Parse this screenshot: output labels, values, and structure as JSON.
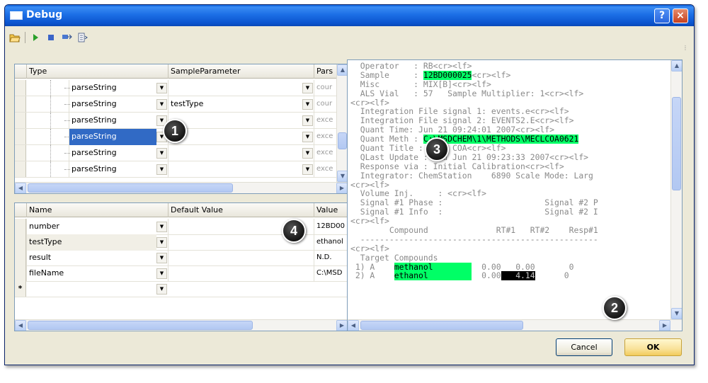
{
  "window": {
    "title": "Debug"
  },
  "controls": {
    "help": "?",
    "close": "×"
  },
  "toolbar": {
    "icons": [
      "folder-open-icon",
      "play-icon",
      "stop-icon",
      "step-icon",
      "watch-icon"
    ]
  },
  "top_grid": {
    "headers": [
      "Type",
      "SampleParameter",
      "Pars"
    ],
    "rows": [
      {
        "type": "parseString",
        "param": "",
        "pars": "cour",
        "selected": false
      },
      {
        "type": "parseString",
        "param": "testType",
        "pars": "cour",
        "selected": false
      },
      {
        "type": "parseString",
        "param": "",
        "pars": "exce",
        "selected": false
      },
      {
        "type": "parseString",
        "param": "",
        "pars": "exce",
        "selected": true
      },
      {
        "type": "parseString",
        "param": "",
        "pars": "exce",
        "selected": false
      },
      {
        "type": "parseString",
        "param": "",
        "pars": "exce",
        "selected": false
      }
    ]
  },
  "bottom_grid": {
    "headers": [
      "Name",
      "Default Value",
      "Value"
    ],
    "rows": [
      {
        "name": "number",
        "default": "",
        "value": "12BD00"
      },
      {
        "name": "testType",
        "default": "",
        "value": "ethanol"
      },
      {
        "name": "result",
        "default": "",
        "value": "N.D."
      },
      {
        "name": "fileName",
        "default": "",
        "value": "C:\\MSD"
      }
    ],
    "new_row_marker": "*"
  },
  "report": {
    "lines": [
      [
        {
          "t": "  Operator   : RB<cr><lf>"
        }
      ],
      [
        {
          "t": "  Sample     : "
        },
        {
          "t": "12BD000025",
          "hl": true
        },
        {
          "t": "<cr><lf>"
        }
      ],
      [
        {
          "t": "  Misc       : MIX[B]<cr><lf>"
        }
      ],
      [
        {
          "t": "  ALS Vial   : 57   Sample Multiplier: 1<cr><lf>"
        }
      ],
      [
        {
          "t": "<cr><lf>"
        }
      ],
      [
        {
          "t": "  Integration File signal 1: events.e<cr><lf>"
        }
      ],
      [
        {
          "t": "  Integration File signal 2: EVENTS2.E<cr><lf>"
        }
      ],
      [
        {
          "t": "  Quant Time: Jun 21 09:24:01 2007<cr><lf>"
        }
      ],
      [
        {
          "t": "  Quant Meth : "
        },
        {
          "t": "C:\\MSDCHEM\\1\\METHODS\\MECLCOA0621",
          "hl": true
        }
      ],
      [
        {
          "t": "  Quant Title : MECL COA<cr><lf>"
        }
      ],
      [
        {
          "t": "  QLast Update : Thu Jun 21 09:23:33 2007<cr><lf>"
        }
      ],
      [
        {
          "t": "  Response via : Initial Calibration<cr><lf>"
        }
      ],
      [
        {
          "t": "  Integrator: ChemStation    6890 Scale Mode: Larg"
        }
      ],
      [
        {
          "t": "<cr><lf>"
        }
      ],
      [
        {
          "t": "  Volume Inj.     : <cr><lf>"
        }
      ],
      [
        {
          "t": "  Signal #1 Phase :                     Signal #2 P"
        }
      ],
      [
        {
          "t": "  Signal #1 Info  :                     Signal #2 I"
        }
      ],
      [
        {
          "t": "<cr><lf>"
        }
      ],
      [
        {
          "t": "        Compound              RT#1   RT#2    Resp#1"
        }
      ],
      [
        {
          "t": "  -------------------------------------------------"
        }
      ],
      [
        {
          "t": "<cr><lf>"
        }
      ],
      [
        {
          "t": "  Target Compounds"
        }
      ],
      [
        {
          "t": " 1) A    "
        },
        {
          "t": "methanol        ",
          "hl": true
        },
        {
          "t": "  0.00   0.00       0"
        }
      ],
      [
        {
          "t": " 2) A    "
        },
        {
          "t": "ethanol         ",
          "hl": true
        },
        {
          "t": "  0.00"
        },
        {
          "t": "   4.14",
          "dark": true
        },
        {
          "t": "      0"
        }
      ]
    ]
  },
  "badges": [
    "1",
    "2",
    "3",
    "4"
  ],
  "buttons": {
    "cancel": "Cancel",
    "ok": "OK"
  }
}
